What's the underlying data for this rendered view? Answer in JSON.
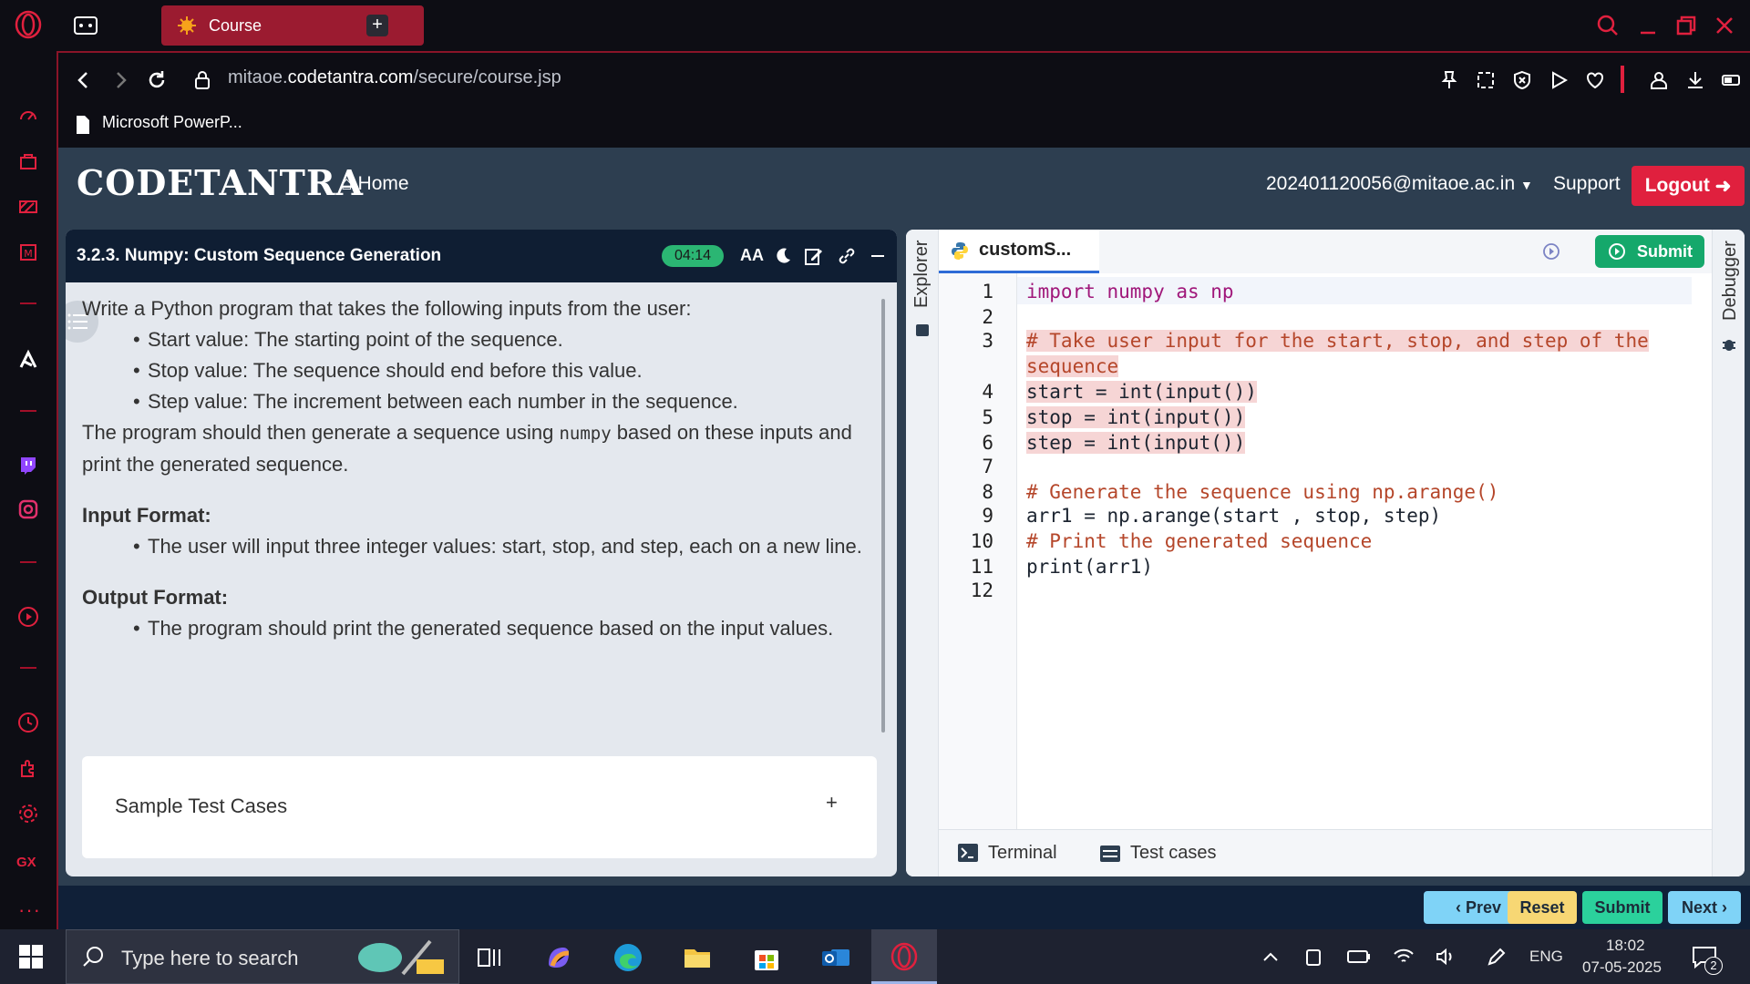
{
  "browser": {
    "tab_title": "Course",
    "url_prefix": "mitaoe.",
    "url_domain": "codetantra.com",
    "url_path": "/secure/course.jsp",
    "bookmark": "Microsoft PowerP...",
    "sidebar_bottom_label": "GX"
  },
  "site": {
    "logo": "CODETANTRA",
    "home": "Home",
    "email": "202401120056@mitaoe.ac.in",
    "support": "Support",
    "logout": "Logout"
  },
  "question": {
    "title": "3.2.3. Numpy: Custom Sequence Generation",
    "timer": "04:14",
    "intro": "Write a Python program that takes the following inputs from the user:",
    "bullets": [
      "Start value: The starting point of the sequence.",
      "Stop value: The sequence should end before this value.",
      "Step value: The increment between each number in the sequence."
    ],
    "para_before": "The program should then generate a sequence using ",
    "para_code": "numpy",
    "para_after": " based on these inputs and print the generated sequence.",
    "input_heading": "Input Format:",
    "input_bullet": "The user will input three integer values: start, stop, and step, each on a new line.",
    "output_heading": "Output Format:",
    "output_bullet": "The program should print the generated sequence based on the input values.",
    "sample_label": "Sample Test Cases",
    "sample_toggle": "+"
  },
  "editor": {
    "explorer_label": "Explorer",
    "debugger_label": "Debugger",
    "file_tab": "customS...",
    "submit_label": "Submit",
    "line_numbers": [
      "1",
      "2",
      "3",
      "4",
      "5",
      "6",
      "7",
      "8",
      "9",
      "10",
      "11",
      "12"
    ],
    "lines": {
      "l1": "import numpy as np",
      "l3a": "# Take user input for the start, stop, and step of the",
      "l3b": "sequence",
      "l4": "start = int(input())",
      "l5": "stop = int(input())",
      "l6": "step = int(input())",
      "l8": "# Generate the sequence using np.arange()",
      "l9": "arr1 = np.arange(start , stop, step)",
      "l10": "# Print the generated sequence",
      "l11": "print(arr1)"
    },
    "terminal_label": "Terminal",
    "testcases_label": "Test cases"
  },
  "footer": {
    "prev": "‹ Prev",
    "reset": "Reset",
    "submit": "Submit",
    "next": "Next ›",
    "colors": {
      "prev": "#7fd3f7",
      "reset": "#f7d774",
      "submit": "#2bd19c",
      "next": "#7fd3f7"
    }
  },
  "taskbar": {
    "search_placeholder": "Type here to search",
    "lang": "ENG",
    "time": "18:02",
    "date": "07-05-2025",
    "notifications": "2"
  }
}
